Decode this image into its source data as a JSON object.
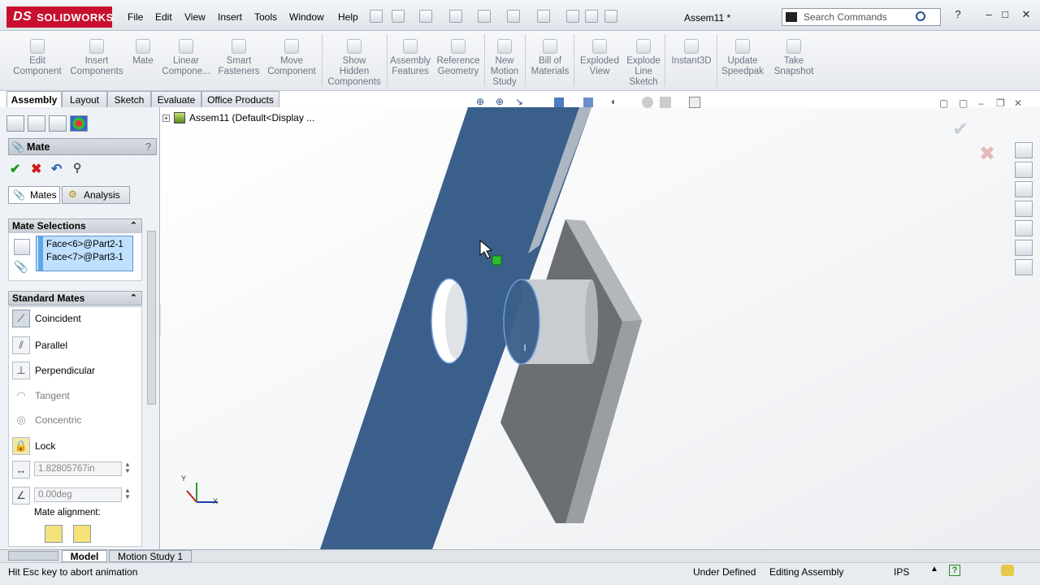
{
  "app": {
    "brand": "SOLIDWORKS",
    "doc_title": "Assem11 *"
  },
  "menu": [
    "File",
    "Edit",
    "View",
    "Insert",
    "Tools",
    "Window",
    "Help"
  ],
  "search": {
    "placeholder": "Search Commands"
  },
  "commands": [
    {
      "label": "Edit\nComponent",
      "icon": "edit-component-icon"
    },
    {
      "label": "Insert\nComponents",
      "icon": "insert-components-icon"
    },
    {
      "label": "Mate",
      "icon": "mate-icon"
    },
    {
      "label": "Linear\nCompone...",
      "icon": "linear-pattern-icon"
    },
    {
      "label": "Smart\nFasteners",
      "icon": "smart-fasteners-icon"
    },
    {
      "label": "Move\nComponent",
      "icon": "move-component-icon"
    },
    {
      "label": "Show\nHidden\nComponents",
      "icon": "show-hidden-icon"
    },
    {
      "label": "Assembly\nFeatures",
      "icon": "assembly-features-icon"
    },
    {
      "label": "Reference\nGeometry",
      "icon": "reference-geometry-icon"
    },
    {
      "label": "New\nMotion\nStudy",
      "icon": "motion-study-icon"
    },
    {
      "label": "Bill of\nMaterials",
      "icon": "bom-icon"
    },
    {
      "label": "Exploded\nView",
      "icon": "exploded-view-icon"
    },
    {
      "label": "Explode\nLine\nSketch",
      "icon": "explode-line-icon"
    },
    {
      "label": "Instant3D",
      "icon": "instant3d-icon"
    },
    {
      "label": "Update\nSpeedpak",
      "icon": "speedpak-icon"
    },
    {
      "label": "Take\nSnapshot",
      "icon": "snapshot-icon"
    }
  ],
  "tabs": [
    "Assembly",
    "Layout",
    "Sketch",
    "Evaluate",
    "Office Products"
  ],
  "property_manager": {
    "title": "Mate",
    "help": "?",
    "subtabs": [
      "Mates",
      "Analysis"
    ],
    "mate_selections": {
      "header": "Mate Selections",
      "items": [
        "Face<6>@Part2-1",
        "Face<7>@Part3-1"
      ]
    },
    "standard_mates": {
      "header": "Standard Mates",
      "items": [
        {
          "label": "Coincident",
          "enabled": true
        },
        {
          "label": "Parallel",
          "enabled": true
        },
        {
          "label": "Perpendicular",
          "enabled": true
        },
        {
          "label": "Tangent",
          "enabled": false
        },
        {
          "label": "Concentric",
          "enabled": false
        },
        {
          "label": "Lock",
          "enabled": true
        }
      ],
      "distance": "1.82805767in",
      "angle": "0.00deg",
      "alignment_label": "Mate alignment:"
    }
  },
  "tree": {
    "root": "Assem11  (Default<Display ..."
  },
  "bottom_tabs": [
    "Model",
    "Motion Study 1"
  ],
  "status": {
    "message": "Hit Esc key to abort animation",
    "state": "Under Defined",
    "mode": "Editing Assembly",
    "units": "IPS"
  },
  "colors": {
    "brand": "#c8102e",
    "part_blue": "#3a5f8a",
    "selection": "#bfe0ff"
  }
}
